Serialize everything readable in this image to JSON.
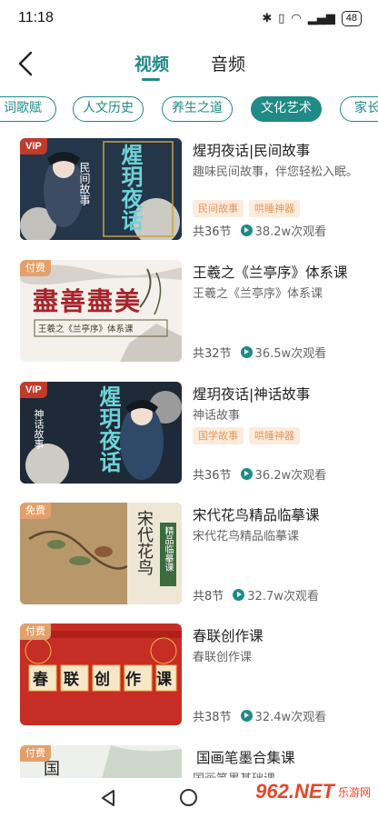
{
  "status": {
    "time": "11:18",
    "battery": "48"
  },
  "header": {
    "tabs": [
      {
        "label": "视频"
      },
      {
        "label": "音频"
      }
    ]
  },
  "categories": [
    {
      "label": "词歌赋"
    },
    {
      "label": "人文历史"
    },
    {
      "label": "养生之道"
    },
    {
      "label": "文化艺术"
    },
    {
      "label": "家长"
    }
  ],
  "courses": [
    {
      "badge": "VIP",
      "title": "煋玥夜话|民间故事",
      "desc": "趣味民间故事，伴您轻松入眠。",
      "tags": [
        "民间故事",
        "哄睡神器"
      ],
      "lessons": "共36节",
      "views": "38.2w次观看",
      "thumb": {
        "big": "煋玥夜话",
        "sub": "民间故事"
      }
    },
    {
      "badge": "付费",
      "title": "王羲之《兰亭序》体系课",
      "desc": "王羲之《兰亭序》体系课",
      "tags": [],
      "lessons": "共32节",
      "views": "36.5w次观看",
      "thumb": {
        "big": "盡善盡美",
        "sub": "王羲之《兰亭序》体系课"
      }
    },
    {
      "badge": "VIP",
      "title": "煋玥夜话|神话故事",
      "desc": "神话故事",
      "tags": [
        "国学故事",
        "哄睡神器"
      ],
      "lessons": "共36节",
      "views": "36.2w次观看",
      "thumb": {
        "big": "煋玥夜话",
        "sub": "神话故事"
      }
    },
    {
      "badge": "免费",
      "title": "宋代花鸟精品临摹课",
      "desc": "宋代花鸟精品临摹课",
      "tags": [],
      "lessons": "共8节",
      "views": "32.7w次观看",
      "thumb": {
        "big": "宋代花鸟",
        "sub": "精品临摹课"
      }
    },
    {
      "badge": "付费",
      "title": "春联创作课",
      "desc": "春联创作课",
      "tags": [],
      "lessons": "共38节",
      "views": "32.4w次观看",
      "thumb": {
        "big": "春联创作课",
        "sub": ""
      }
    },
    {
      "badge": "付费",
      "title": "国画笔墨合集课",
      "desc": "国画笔墨基础课",
      "tags": [],
      "lessons": "",
      "views": "",
      "thumb": {
        "big": "国",
        "sub": ""
      }
    }
  ],
  "watermark": {
    "logo": "962.NET",
    "text": "乐游网"
  },
  "colors": {
    "accent": "#1f8a86",
    "tag_bg": "#fdebdb",
    "tag_fg": "#e09a5f",
    "vip": "#c23a2b"
  }
}
